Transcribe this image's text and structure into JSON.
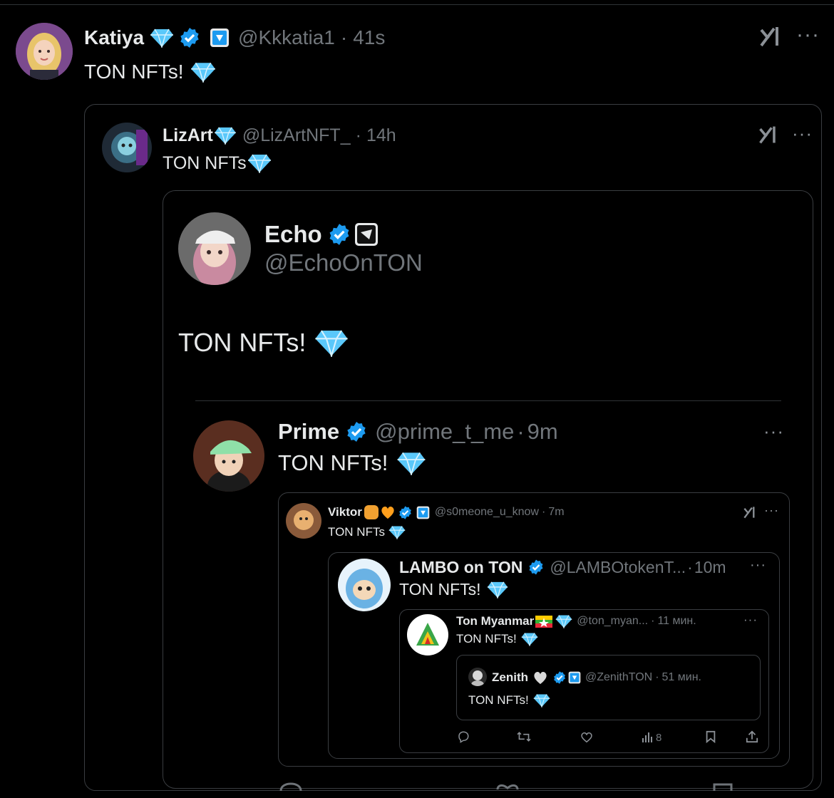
{
  "main": {
    "name": "Katiya",
    "handle": "@Kkkatia1",
    "sep": "·",
    "time": "41s",
    "text": "TON NFTs!"
  },
  "q1": {
    "name": "LizArt",
    "handle": "@LizArtNFT_",
    "sep": "·",
    "time": "14h",
    "text": "TON NFTs"
  },
  "echo": {
    "name": "Echo",
    "handle": "@EchoOnTON",
    "text": "TON NFTs!"
  },
  "prime": {
    "name": "Prime",
    "handle": "@prime_t_me",
    "sep": "·",
    "time": "9m",
    "text": "TON NFTs!"
  },
  "viktor": {
    "name": "Viktor",
    "handle": "@s0meone_u_know",
    "sep": "·",
    "time": "7m",
    "text": "TON NFTs"
  },
  "lambo": {
    "name": "LAMBO on TON",
    "handle": "@LAMBOtokenT...",
    "sep": "·",
    "time": "10m",
    "text": "TON NFTs!"
  },
  "myanmar": {
    "name": "Ton Myanmar",
    "handle": "@ton_myan...",
    "sep": "·",
    "time": "11 мин.",
    "text": "TON NFTs!"
  },
  "zenith": {
    "name": "Zenith",
    "handle": "@ZenithTON",
    "sep": "·",
    "time": "51 мин.",
    "text": "TON NFTs!"
  },
  "actions": {
    "views": "8"
  },
  "colors": {
    "background": "#000000",
    "verified": "#1d9bf0",
    "diamond": "#5ac8fa",
    "muted": "#71767b"
  }
}
